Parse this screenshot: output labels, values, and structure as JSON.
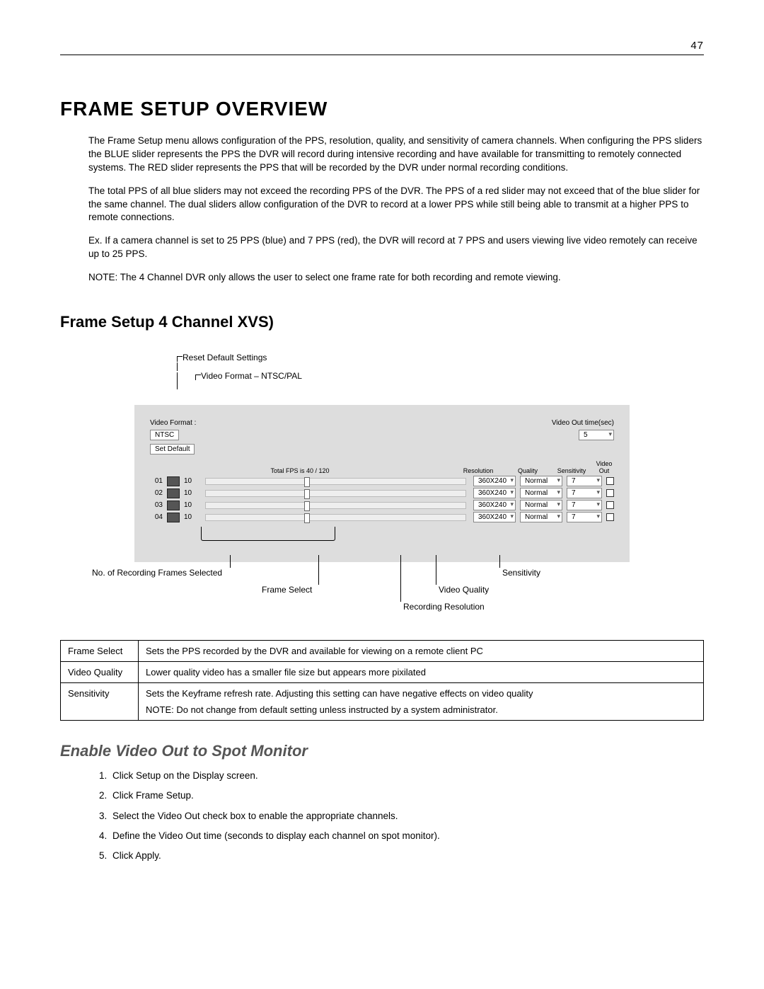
{
  "page_number": "47",
  "title": "FRAME SETUP OVERVIEW",
  "paragraphs": {
    "p1": "The Frame Setup menu allows configuration of the PPS, resolution, quality, and sensitivity of camera channels. When configuring the PPS sliders the BLUE slider represents the PPS the DVR will record during intensive recording and have available for transmitting to remotely connected systems. The RED slider represents the PPS that will be recorded by the DVR under normal recording conditions.",
    "p2": "The total PPS of all blue sliders may not exceed the recording PPS of the DVR. The PPS of a red slider may not exceed that of the blue slider for the same channel. The dual sliders allow configuration of the DVR to record at a lower PPS while still being able to transmit at a higher PPS to remote connections.",
    "p3": "Ex. If a camera channel is set to 25 PPS (blue) and 7 PPS (red), the DVR will record at 7 PPS and users viewing live video remotely can receive up to 25 PPS.",
    "p4": "NOTE: The 4 Channel DVR only allows the user to select one frame rate for both recording and remote viewing."
  },
  "subheading": "Frame Setup 4 Channel XVS)",
  "diagram": {
    "callout_reset": "Reset Default Settings",
    "callout_format": "Video Format – NTSC/PAL",
    "video_format_label": "Video Format :",
    "ntsc": "NTSC",
    "set_default_btn": "Set Default",
    "video_out_time_label": "Video Out time(sec)",
    "video_out_time_value": "5",
    "total_fps": "Total FPS is 40 / 120",
    "col_resolution": "Resolution",
    "col_quality": "Quality",
    "col_sensitivity": "Sensitivity",
    "col_video_out": "Video\nOut",
    "ch_value": "10",
    "res_opt": "360X240",
    "quality_opt": "Normal",
    "sens_opt": "7",
    "ch": {
      "c1": "01",
      "c2": "02",
      "c3": "03",
      "c4": "04"
    },
    "lower": {
      "frames": "No. of Recording Frames Selected",
      "frame_select": "Frame Select",
      "rec_res": "Recording Resolution",
      "video_quality": "Video Quality",
      "sensitivity": "Sensitivity"
    }
  },
  "defs": {
    "r1k": "Frame Select",
    "r1v": "Sets the PPS recorded by the DVR and available for viewing on a remote client PC",
    "r2k": "Video Quality",
    "r2v": "Lower quality video has a smaller file size but appears more pixilated",
    "r3k": "Sensitivity",
    "r3v1": "Sets the Keyframe refresh rate.  Adjusting this setting can have negative effects on video quality",
    "r3v2": "NOTE:  Do not change from default setting unless instructed by a system administrator."
  },
  "enable_heading": "Enable Video Out to Spot Monitor",
  "steps": {
    "s1": "Click Setup on the Display screen.",
    "s2": "Click Frame Setup.",
    "s3": "Select the Video Out check box to enable the appropriate channels.",
    "s4": "Define the Video Out time (seconds to display each channel on spot monitor).",
    "s5": "Click Apply."
  }
}
